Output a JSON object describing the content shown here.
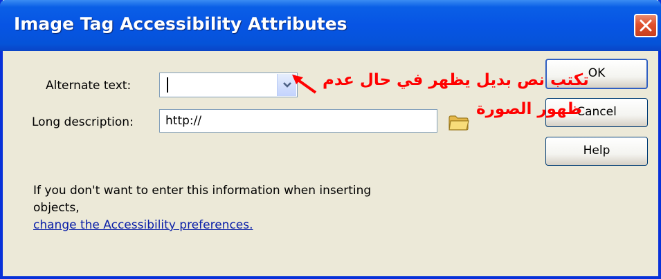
{
  "window": {
    "title": "Image Tag Accessibility Attributes"
  },
  "form": {
    "alt_text": {
      "label": "Alternate text:",
      "value": ""
    },
    "long_desc": {
      "label": "Long description:",
      "value": "http://"
    }
  },
  "buttons": {
    "ok": "OK",
    "cancel": "Cancel",
    "help": "Help"
  },
  "info": {
    "text": "If you don't want to enter this information when inserting objects,",
    "link": "change the Accessibility preferences."
  },
  "annotation": {
    "line1": "تكتب نص بديل يظهر في حال عدم",
    "line2": "ظهور الصورة",
    "color": "#ff0000"
  },
  "icons": {
    "close": "close-icon",
    "dropdown": "chevron-down-icon",
    "browse": "folder-icon",
    "arrow": "arrow-annotation-icon"
  }
}
